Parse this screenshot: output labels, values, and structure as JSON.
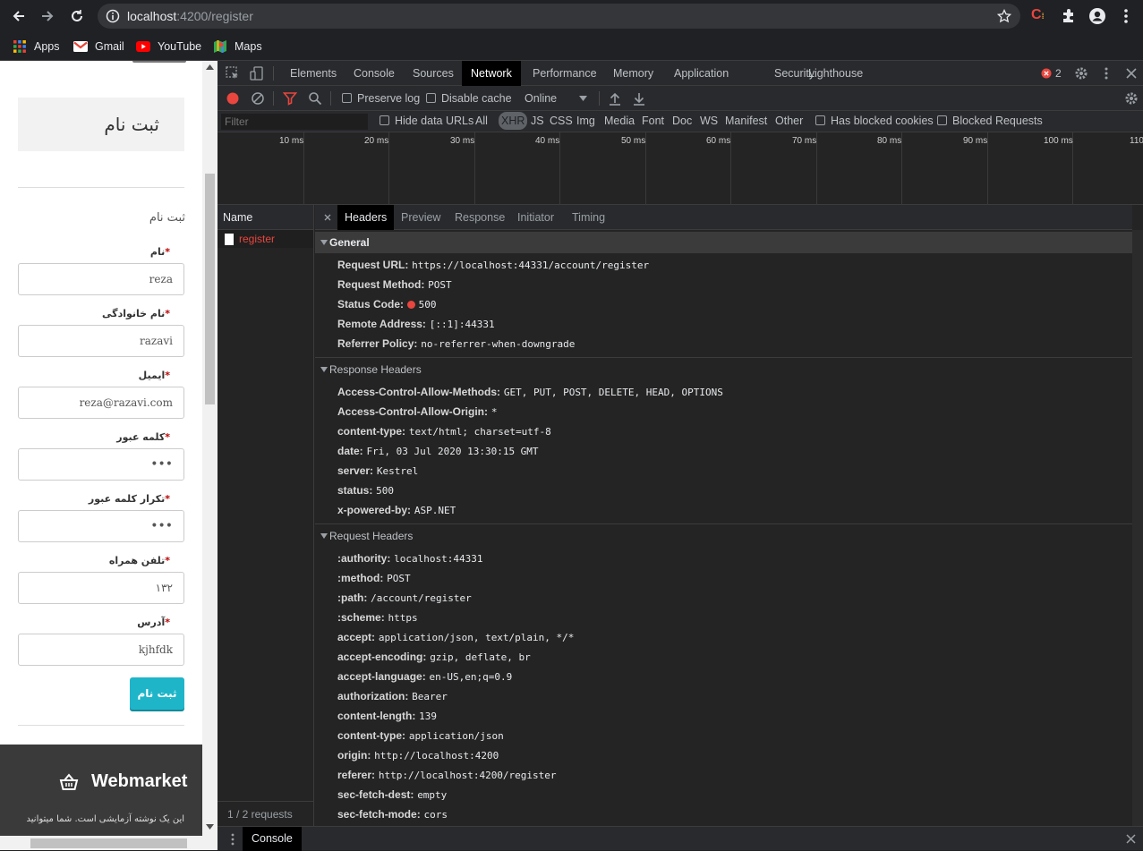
{
  "browser": {
    "url_host": "localhost",
    "url_rest": ":4200/register",
    "bookmarks": [
      {
        "label": "Apps",
        "icon": "apps-grid-icon"
      },
      {
        "label": "Gmail",
        "icon": "gmail-icon"
      },
      {
        "label": "YouTube",
        "icon": "youtube-icon"
      },
      {
        "label": "Maps",
        "icon": "maps-icon"
      }
    ]
  },
  "page": {
    "card_title": "ثبت نام",
    "subtitle": "ثبت نام",
    "fields": [
      {
        "label": "نام",
        "value": "reza"
      },
      {
        "label": "نام خانوادگی",
        "value": "razavi"
      },
      {
        "label": "ایمیل",
        "value": "reza@razavi.com"
      },
      {
        "label": "کلمه عبور",
        "value": "•••"
      },
      {
        "label": "تکرار کلمه عبور",
        "value": "•••"
      },
      {
        "label": "تلفن همراه",
        "value": "۱۳۲"
      },
      {
        "label": "آدرس",
        "value": "kjhfdk"
      }
    ],
    "required_mark": "*",
    "submit_label": "ثبت نام",
    "footer_brand": "Webmarket",
    "footer_text": "این یک نوشته آزمایشی است. شما میتوانید",
    "accent_color": "#1fb5c9"
  },
  "devtools": {
    "tabs": [
      "Elements",
      "Console",
      "Sources",
      "Network",
      "Performance",
      "Memory",
      "Application",
      "Security",
      "Lighthouse"
    ],
    "active_tab": "Network",
    "error_count": "2",
    "toolbar": {
      "preserve_log": "Preserve log",
      "disable_cache": "Disable cache",
      "throttle": "Online"
    },
    "filter": {
      "placeholder": "Filter",
      "hide_data_urls": "Hide data URLs",
      "types": [
        "All",
        "XHR",
        "JS",
        "CSS",
        "Img",
        "Media",
        "Font",
        "Doc",
        "WS",
        "Manifest",
        "Other"
      ],
      "active_type": "XHR",
      "blocked_cookies": "Has blocked cookies",
      "blocked_requests": "Blocked Requests"
    },
    "timeline_ticks": [
      "10 ms",
      "20 ms",
      "30 ms",
      "40 ms",
      "50 ms",
      "60 ms",
      "70 ms",
      "80 ms",
      "90 ms",
      "100 ms",
      "110"
    ],
    "name_header": "Name",
    "requests": [
      {
        "name": "register",
        "status": "error"
      }
    ],
    "request_count": "1 / 2 requests",
    "detail_tabs": [
      "Headers",
      "Preview",
      "Response",
      "Initiator",
      "Timing"
    ],
    "active_detail_tab": "Headers",
    "general": {
      "title": "General",
      "rows": [
        {
          "k": "Request URL:",
          "v": "https://localhost:44331/account/register"
        },
        {
          "k": "Request Method:",
          "v": "POST"
        },
        {
          "k": "Status Code:",
          "v": "500"
        },
        {
          "k": "Remote Address:",
          "v": "[::1]:44331"
        },
        {
          "k": "Referrer Policy:",
          "v": "no-referrer-when-downgrade"
        }
      ]
    },
    "response_headers": {
      "title": "Response Headers",
      "rows": [
        {
          "k": "Access-Control-Allow-Methods:",
          "v": "GET, PUT, POST, DELETE, HEAD, OPTIONS"
        },
        {
          "k": "Access-Control-Allow-Origin:",
          "v": "*"
        },
        {
          "k": "content-type:",
          "v": "text/html; charset=utf-8"
        },
        {
          "k": "date:",
          "v": "Fri, 03 Jul 2020 13:30:15 GMT"
        },
        {
          "k": "server:",
          "v": "Kestrel"
        },
        {
          "k": "status:",
          "v": "500"
        },
        {
          "k": "x-powered-by:",
          "v": "ASP.NET"
        }
      ]
    },
    "request_headers": {
      "title": "Request Headers",
      "rows": [
        {
          "k": ":authority:",
          "v": "localhost:44331"
        },
        {
          "k": ":method:",
          "v": "POST"
        },
        {
          "k": ":path:",
          "v": "/account/register"
        },
        {
          "k": ":scheme:",
          "v": "https"
        },
        {
          "k": "accept:",
          "v": "application/json, text/plain, */*"
        },
        {
          "k": "accept-encoding:",
          "v": "gzip, deflate, br"
        },
        {
          "k": "accept-language:",
          "v": "en-US,en;q=0.9"
        },
        {
          "k": "authorization:",
          "v": "Bearer"
        },
        {
          "k": "content-length:",
          "v": "139"
        },
        {
          "k": "content-type:",
          "v": "application/json"
        },
        {
          "k": "origin:",
          "v": "http://localhost:4200"
        },
        {
          "k": "referer:",
          "v": "http://localhost:4200/register"
        },
        {
          "k": "sec-fetch-dest:",
          "v": "empty"
        },
        {
          "k": "sec-fetch-mode:",
          "v": "cors"
        }
      ]
    },
    "drawer_tab": "Console"
  }
}
